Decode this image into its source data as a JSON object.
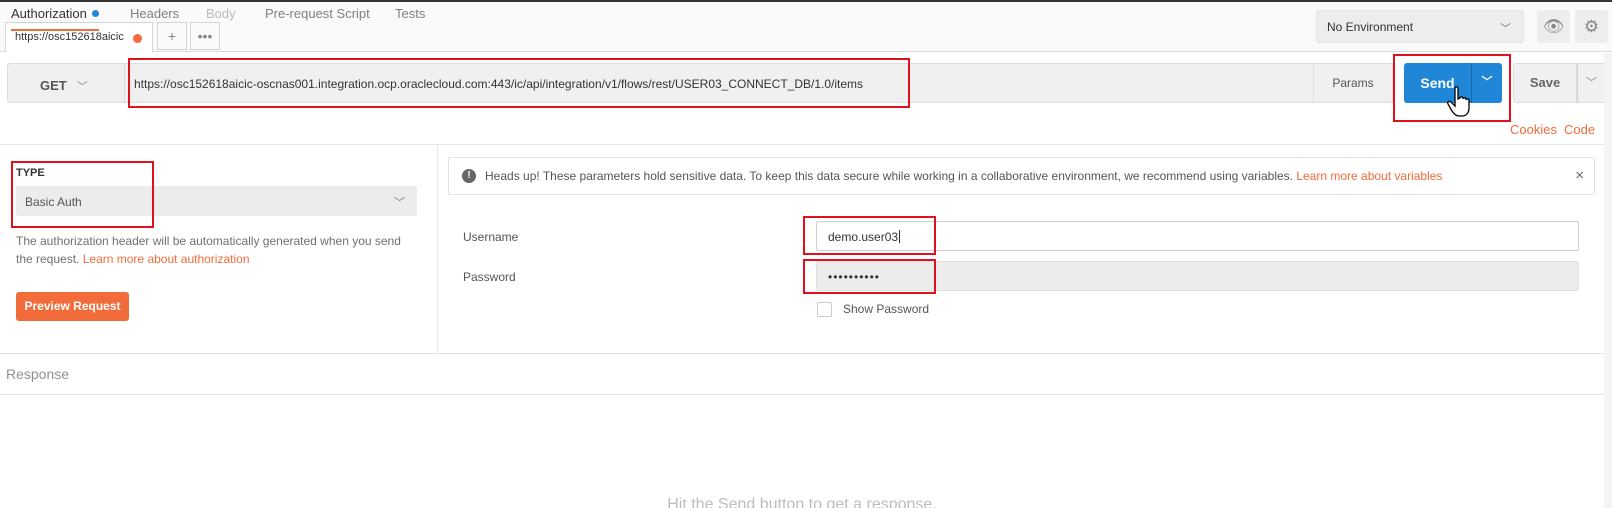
{
  "topbar": {
    "tab_title": "https://osc152618aicic",
    "environment": "No Environment",
    "icons": [
      "plus-icon",
      "ellipsis-icon",
      "eye-icon",
      "gear-icon",
      "chevron-down-icon"
    ]
  },
  "request": {
    "method": "GET",
    "url": "https://osc152618aicic-oscnas001.integration.ocp.oraclecloud.com:443/ic/api/integration/v1/flows/rest/USER03_CONNECT_DB/1.0/items",
    "params_label": "Params",
    "send_label": "Send",
    "save_label": "Save"
  },
  "subtabs": {
    "authorization": "Authorization",
    "headers": "Headers",
    "body": "Body",
    "prerequest": "Pre-request Script",
    "tests": "Tests",
    "cookies": "Cookies",
    "code": "Code"
  },
  "auth": {
    "type_label": "TYPE",
    "type_value": "Basic Auth",
    "description": "The authorization header will be automatically generated when you send the request. ",
    "learn_more": "Learn more about authorization",
    "preview_button": "Preview Request"
  },
  "notice": {
    "text": "Heads up! These parameters hold sensitive data. To keep this data secure while working in a collaborative environment, we recommend using variables. ",
    "link": "Learn more about variables",
    "close": "×"
  },
  "fields": {
    "username_label": "Username",
    "username_value": "demo.user03",
    "password_label": "Password",
    "password_value": "••••••••••",
    "show_password": "Show Password"
  },
  "response": {
    "title": "Response",
    "empty_message": "Hit the Send button to get a response."
  },
  "colors": {
    "accent": "#f26b3a",
    "send_blue": "#1f86d8",
    "highlight_red": "#e0101f"
  }
}
